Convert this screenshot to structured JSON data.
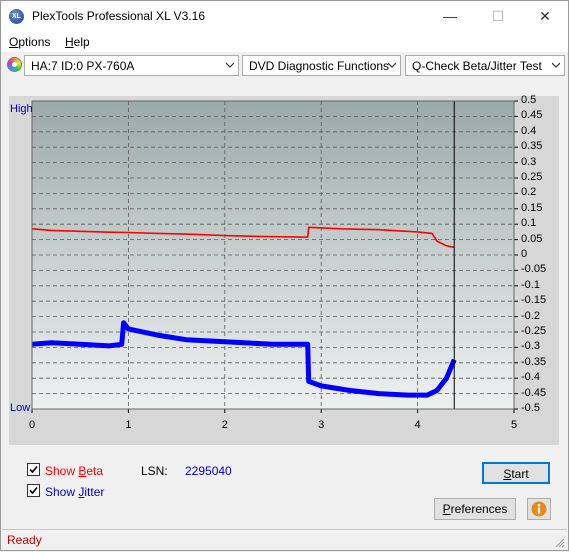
{
  "window": {
    "title": "PlexTools Professional XL V3.16",
    "app_icon_text": "XL",
    "minimize": "—",
    "maximize": "☐",
    "close": "✕"
  },
  "menu": {
    "options_first": "O",
    "options_rest": "ptions",
    "help_first": "H",
    "help_rest": "elp"
  },
  "toolbar": {
    "drive": "HA:7 ID:0  PX-760A",
    "function": "DVD Diagnostic Functions",
    "test": "Q-Check Beta/Jitter Test"
  },
  "chart_labels": {
    "high": "High",
    "low": "Low"
  },
  "chart_data": {
    "type": "line",
    "title": "",
    "xlabel": "",
    "ylabel": "",
    "xlim": [
      0,
      5
    ],
    "ylim": [
      -0.5,
      0.5
    ],
    "x_ticks": [
      "0",
      "1",
      "2",
      "3",
      "4",
      "5"
    ],
    "y_ticks": [
      "0.5",
      "0.45",
      "0.4",
      "0.35",
      "0.3",
      "0.25",
      "0.2",
      "0.15",
      "0.1",
      "0.05",
      "0",
      "-0.05",
      "-0.1",
      "-0.15",
      "-0.2",
      "-0.25",
      "-0.3",
      "-0.35",
      "-0.4",
      "-0.45",
      "-0.5"
    ],
    "grid": true,
    "cursor_x": 4.38,
    "series": [
      {
        "color": "#ff0000",
        "x": [
          0,
          0.2,
          0.5,
          0.8,
          1.0,
          1.3,
          1.6,
          2.0,
          2.4,
          2.8,
          2.86,
          2.87,
          3.2,
          3.6,
          4.0,
          4.15,
          4.2,
          4.3,
          4.38
        ],
        "y": [
          0.085,
          0.08,
          0.077,
          0.074,
          0.073,
          0.07,
          0.068,
          0.063,
          0.06,
          0.058,
          0.058,
          0.09,
          0.085,
          0.082,
          0.075,
          0.07,
          0.045,
          0.03,
          0.025
        ]
      },
      {
        "color": "#0000ff",
        "x": [
          0,
          0.2,
          0.5,
          0.8,
          0.93,
          0.95,
          1.0,
          1.3,
          1.6,
          1.9,
          2.2,
          2.5,
          2.8,
          2.86,
          2.87,
          3.0,
          3.3,
          3.6,
          3.9,
          4.1,
          4.2,
          4.3,
          4.38
        ],
        "y": [
          -0.29,
          -0.285,
          -0.29,
          -0.295,
          -0.29,
          -0.22,
          -0.24,
          -0.26,
          -0.275,
          -0.28,
          -0.285,
          -0.29,
          -0.29,
          -0.29,
          -0.41,
          -0.425,
          -0.44,
          -0.45,
          -0.455,
          -0.455,
          -0.44,
          -0.4,
          -0.34
        ]
      }
    ]
  },
  "controls": {
    "show_beta_prefix": "Show ",
    "show_beta_accel": "B",
    "show_beta_rest": "eta",
    "show_jitter_prefix": "Show ",
    "show_jitter_accel": "J",
    "show_jitter_rest": "itter",
    "show_beta_checked": true,
    "show_jitter_checked": true,
    "lsn_label": "LSN:",
    "lsn_value": "2295040",
    "start_accel": "S",
    "start_rest": "tart",
    "preferences_accel": "P",
    "preferences_rest": "references",
    "info_icon": "info-icon"
  },
  "colors": {
    "beta": "#ff0000",
    "jitter": "#0000ff",
    "low_high_label": "#0000c0",
    "status_text": "#c00000"
  },
  "status": {
    "text": "Ready"
  }
}
